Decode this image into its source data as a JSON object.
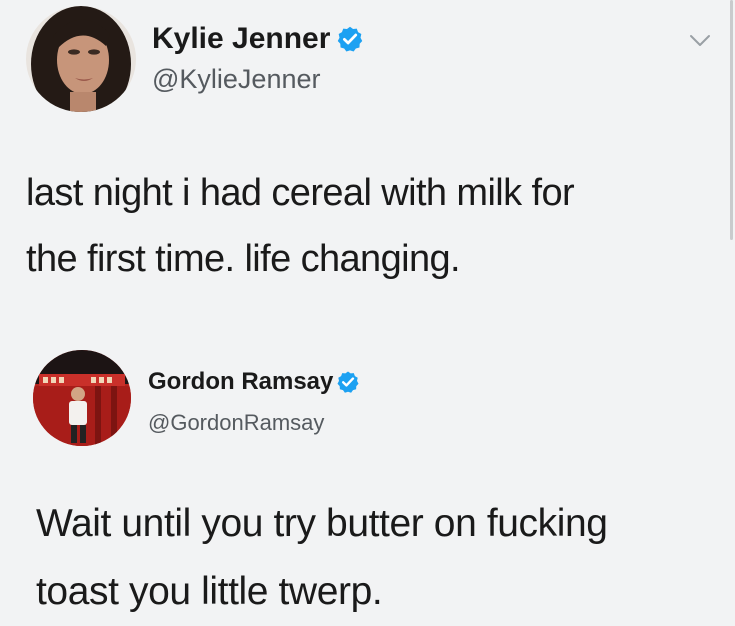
{
  "tweets": [
    {
      "display_name": "Kylie Jenner",
      "handle": "@KylieJenner",
      "verified": true,
      "avatar_icon": "profile-photo-woman",
      "text": "last night i had cereal with milk for\nthe first time. life changing."
    },
    {
      "display_name": "Gordon Ramsay",
      "handle": "@GordonRamsay",
      "verified": true,
      "avatar_icon": "profile-photo-chef-red-background",
      "text": "Wait until you try butter on fucking\ntoast you little twerp."
    }
  ],
  "icons": {
    "verified": "verified-badge-icon",
    "menu": "chevron-down-icon"
  },
  "colors": {
    "background": "#f2f3f4",
    "verified_blue": "#1da1f2",
    "handle_gray": "#555a5f",
    "text": "#1a1a1a"
  }
}
